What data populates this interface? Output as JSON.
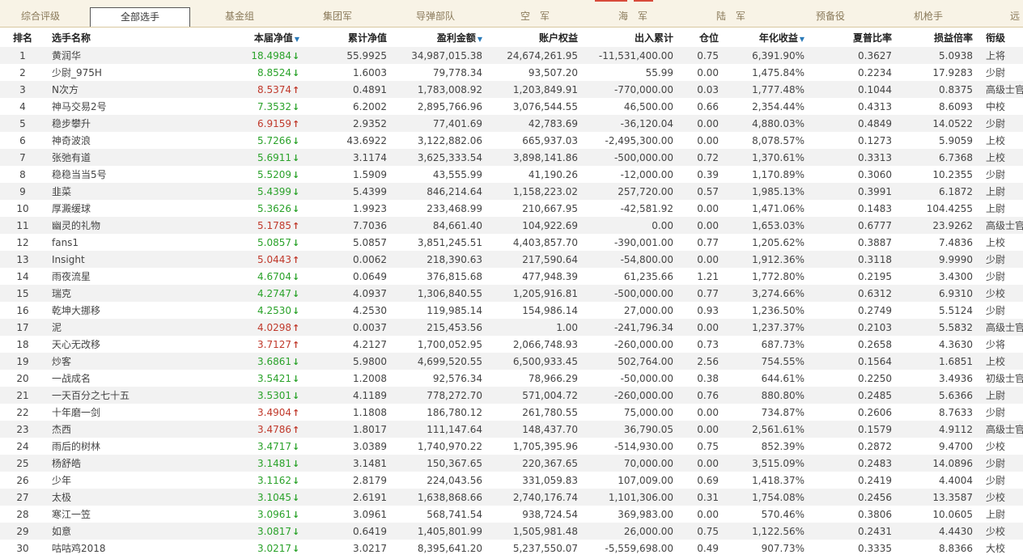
{
  "tabs": [
    {
      "label": "综合评级",
      "active": false
    },
    {
      "label": "全部选手",
      "active": true
    },
    {
      "label": "基金组",
      "active": false
    },
    {
      "label": "集团军",
      "active": false
    },
    {
      "label": "导弹部队",
      "active": false
    },
    {
      "label": "空　军",
      "active": false
    },
    {
      "label": "海　军",
      "active": false
    },
    {
      "label": "陆　军",
      "active": false
    },
    {
      "label": "预备役",
      "active": false
    },
    {
      "label": "机枪手",
      "active": false
    },
    {
      "label": "远",
      "active": false
    }
  ],
  "sort_indicator": "▼",
  "columns": [
    "排名",
    "选手名称",
    "本届净值",
    "累计净值",
    "盈利金额",
    "账户权益",
    "出入累计",
    "仓位",
    "年化收益",
    "夏普比率",
    "损益倍率",
    "衔级"
  ],
  "colors": {
    "up": "#c0392b",
    "down": "#2aa22a",
    "tab_bg": "#f8f3e6"
  },
  "rows": [
    {
      "rank": "1",
      "name": "黄润华",
      "nav": "18.4984",
      "dir": "down",
      "cum": "55.9925",
      "profit": "34,987,015.38",
      "equity": "24,674,261.95",
      "flow": "-11,531,400.00",
      "pos": "0.75",
      "annual": "6,391.90%",
      "sharpe": "0.3627",
      "ratio": "5.0938",
      "title": "上将"
    },
    {
      "rank": "2",
      "name": "少尉_975H",
      "nav": "8.8524",
      "dir": "down",
      "cum": "1.6003",
      "profit": "79,778.34",
      "equity": "93,507.20",
      "flow": "55.99",
      "pos": "0.00",
      "annual": "1,475.84%",
      "sharpe": "0.2234",
      "ratio": "17.9283",
      "title": "少尉"
    },
    {
      "rank": "3",
      "name": "N次方",
      "nav": "8.5374",
      "dir": "up",
      "cum": "0.4891",
      "profit": "1,783,008.92",
      "equity": "1,203,849.91",
      "flow": "-770,000.00",
      "pos": "0.03",
      "annual": "1,777.48%",
      "sharpe": "0.1044",
      "ratio": "0.8375",
      "title": "高级士官"
    },
    {
      "rank": "4",
      "name": "神马交易2号",
      "nav": "7.3532",
      "dir": "down",
      "cum": "6.2002",
      "profit": "2,895,766.96",
      "equity": "3,076,544.55",
      "flow": "46,500.00",
      "pos": "0.66",
      "annual": "2,354.44%",
      "sharpe": "0.4313",
      "ratio": "8.6093",
      "title": "中校"
    },
    {
      "rank": "5",
      "name": "稳步攀升",
      "nav": "6.9159",
      "dir": "up",
      "cum": "2.9352",
      "profit": "77,401.69",
      "equity": "42,783.69",
      "flow": "-36,120.04",
      "pos": "0.00",
      "annual": "4,880.03%",
      "sharpe": "0.4849",
      "ratio": "14.0522",
      "title": "少尉"
    },
    {
      "rank": "6",
      "name": "神奇波浪",
      "nav": "5.7266",
      "dir": "down",
      "cum": "43.6922",
      "profit": "3,122,882.06",
      "equity": "665,937.03",
      "flow": "-2,495,300.00",
      "pos": "0.00",
      "annual": "8,078.57%",
      "sharpe": "0.1273",
      "ratio": "5.9059",
      "title": "上校"
    },
    {
      "rank": "7",
      "name": "张弛有道",
      "nav": "5.6911",
      "dir": "down",
      "cum": "3.1174",
      "profit": "3,625,333.54",
      "equity": "3,898,141.86",
      "flow": "-500,000.00",
      "pos": "0.72",
      "annual": "1,370.61%",
      "sharpe": "0.3313",
      "ratio": "6.7368",
      "title": "上校"
    },
    {
      "rank": "8",
      "name": "稳稳当当5号",
      "nav": "5.5209",
      "dir": "down",
      "cum": "1.5909",
      "profit": "43,555.99",
      "equity": "41,190.26",
      "flow": "-12,000.00",
      "pos": "0.39",
      "annual": "1,170.89%",
      "sharpe": "0.3060",
      "ratio": "10.2355",
      "title": "少尉"
    },
    {
      "rank": "9",
      "name": "韭菜",
      "nav": "5.4399",
      "dir": "down",
      "cum": "5.4399",
      "profit": "846,214.64",
      "equity": "1,158,223.02",
      "flow": "257,720.00",
      "pos": "0.57",
      "annual": "1,985.13%",
      "sharpe": "0.3991",
      "ratio": "6.1872",
      "title": "上尉"
    },
    {
      "rank": "10",
      "name": "厚澱缓球",
      "nav": "5.3626",
      "dir": "down",
      "cum": "1.9923",
      "profit": "233,468.99",
      "equity": "210,667.95",
      "flow": "-42,581.92",
      "pos": "0.00",
      "annual": "1,471.06%",
      "sharpe": "0.1483",
      "ratio": "104.4255",
      "title": "上尉"
    },
    {
      "rank": "11",
      "name": "幽灵的礼物",
      "nav": "5.1785",
      "dir": "up",
      "cum": "7.7036",
      "profit": "84,661.40",
      "equity": "104,922.69",
      "flow": "0.00",
      "pos": "0.00",
      "annual": "1,653.03%",
      "sharpe": "0.6777",
      "ratio": "23.9262",
      "title": "高级士官"
    },
    {
      "rank": "12",
      "name": "fans1",
      "nav": "5.0857",
      "dir": "down",
      "cum": "5.0857",
      "profit": "3,851,245.51",
      "equity": "4,403,857.70",
      "flow": "-390,001.00",
      "pos": "0.77",
      "annual": "1,205.62%",
      "sharpe": "0.3887",
      "ratio": "7.4836",
      "title": "上校"
    },
    {
      "rank": "13",
      "name": "Insight",
      "nav": "5.0443",
      "dir": "up",
      "cum": "0.0062",
      "profit": "218,390.63",
      "equity": "217,590.64",
      "flow": "-54,800.00",
      "pos": "0.00",
      "annual": "1,912.36%",
      "sharpe": "0.3118",
      "ratio": "9.9990",
      "title": "少尉"
    },
    {
      "rank": "14",
      "name": "雨夜流星",
      "nav": "4.6704",
      "dir": "down",
      "cum": "0.0649",
      "profit": "376,815.68",
      "equity": "477,948.39",
      "flow": "61,235.66",
      "pos": "1.21",
      "annual": "1,772.80%",
      "sharpe": "0.2195",
      "ratio": "3.4300",
      "title": "少尉"
    },
    {
      "rank": "15",
      "name": "瑞克",
      "nav": "4.2747",
      "dir": "down",
      "cum": "4.0937",
      "profit": "1,306,840.55",
      "equity": "1,205,916.81",
      "flow": "-500,000.00",
      "pos": "0.77",
      "annual": "3,274.66%",
      "sharpe": "0.6312",
      "ratio": "6.9310",
      "title": "少校"
    },
    {
      "rank": "16",
      "name": "乾坤大挪移",
      "nav": "4.2530",
      "dir": "down",
      "cum": "4.2530",
      "profit": "119,985.14",
      "equity": "154,986.14",
      "flow": "27,000.00",
      "pos": "0.93",
      "annual": "1,236.50%",
      "sharpe": "0.2749",
      "ratio": "5.5124",
      "title": "少尉"
    },
    {
      "rank": "17",
      "name": "泥",
      "nav": "4.0298",
      "dir": "up",
      "cum": "0.0037",
      "profit": "215,453.56",
      "equity": "1.00",
      "flow": "-241,796.34",
      "pos": "0.00",
      "annual": "1,237.37%",
      "sharpe": "0.2103",
      "ratio": "5.5832",
      "title": "高级士官"
    },
    {
      "rank": "18",
      "name": "天心无改移",
      "nav": "3.7127",
      "dir": "up",
      "cum": "4.2127",
      "profit": "1,700,052.95",
      "equity": "2,066,748.93",
      "flow": "-260,000.00",
      "pos": "0.73",
      "annual": "687.73%",
      "sharpe": "0.2658",
      "ratio": "4.3630",
      "title": "少将"
    },
    {
      "rank": "19",
      "name": "炒客",
      "nav": "3.6861",
      "dir": "down",
      "cum": "5.9800",
      "profit": "4,699,520.55",
      "equity": "6,500,933.45",
      "flow": "502,764.00",
      "pos": "2.56",
      "annual": "754.55%",
      "sharpe": "0.1564",
      "ratio": "1.6851",
      "title": "上校"
    },
    {
      "rank": "20",
      "name": "一战成名",
      "nav": "3.5421",
      "dir": "down",
      "cum": "1.2008",
      "profit": "92,576.34",
      "equity": "78,966.29",
      "flow": "-50,000.00",
      "pos": "0.38",
      "annual": "644.61%",
      "sharpe": "0.2250",
      "ratio": "3.4936",
      "title": "初级士官"
    },
    {
      "rank": "21",
      "name": "一天百分之七十五",
      "nav": "3.5301",
      "dir": "down",
      "cum": "4.1189",
      "profit": "778,272.70",
      "equity": "571,004.72",
      "flow": "-260,000.00",
      "pos": "0.76",
      "annual": "880.80%",
      "sharpe": "0.2485",
      "ratio": "5.6366",
      "title": "上尉"
    },
    {
      "rank": "22",
      "name": "十年磨一剑",
      "nav": "3.4904",
      "dir": "up",
      "cum": "1.1808",
      "profit": "186,780.12",
      "equity": "261,780.55",
      "flow": "75,000.00",
      "pos": "0.00",
      "annual": "734.87%",
      "sharpe": "0.2606",
      "ratio": "8.7633",
      "title": "少尉"
    },
    {
      "rank": "23",
      "name": "杰西",
      "nav": "3.4786",
      "dir": "up",
      "cum": "1.8017",
      "profit": "111,147.64",
      "equity": "148,437.70",
      "flow": "36,790.05",
      "pos": "0.00",
      "annual": "2,561.61%",
      "sharpe": "0.1579",
      "ratio": "4.9112",
      "title": "高级士官"
    },
    {
      "rank": "24",
      "name": "雨后的树林",
      "nav": "3.4717",
      "dir": "down",
      "cum": "3.0389",
      "profit": "1,740,970.22",
      "equity": "1,705,395.96",
      "flow": "-514,930.00",
      "pos": "0.75",
      "annual": "852.39%",
      "sharpe": "0.2872",
      "ratio": "9.4700",
      "title": "少校"
    },
    {
      "rank": "25",
      "name": "杨舒皓",
      "nav": "3.1481",
      "dir": "down",
      "cum": "3.1481",
      "profit": "150,367.65",
      "equity": "220,367.65",
      "flow": "70,000.00",
      "pos": "0.00",
      "annual": "3,515.09%",
      "sharpe": "0.2483",
      "ratio": "14.0896",
      "title": "少尉"
    },
    {
      "rank": "26",
      "name": "少年",
      "nav": "3.1162",
      "dir": "down",
      "cum": "2.8179",
      "profit": "224,043.56",
      "equity": "331,059.83",
      "flow": "107,009.00",
      "pos": "0.69",
      "annual": "1,418.37%",
      "sharpe": "0.2419",
      "ratio": "4.4004",
      "title": "少尉"
    },
    {
      "rank": "27",
      "name": "太极",
      "nav": "3.1045",
      "dir": "down",
      "cum": "2.6191",
      "profit": "1,638,868.66",
      "equity": "2,740,176.74",
      "flow": "1,101,306.00",
      "pos": "0.31",
      "annual": "1,754.08%",
      "sharpe": "0.2456",
      "ratio": "13.3587",
      "title": "少校"
    },
    {
      "rank": "28",
      "name": "寒江一笠",
      "nav": "3.0961",
      "dir": "down",
      "cum": "3.0961",
      "profit": "568,741.54",
      "equity": "938,724.54",
      "flow": "369,983.00",
      "pos": "0.00",
      "annual": "570.46%",
      "sharpe": "0.3806",
      "ratio": "10.0605",
      "title": "上尉"
    },
    {
      "rank": "29",
      "name": "如意",
      "nav": "3.0817",
      "dir": "down",
      "cum": "0.6419",
      "profit": "1,405,801.99",
      "equity": "1,505,981.48",
      "flow": "26,000.00",
      "pos": "0.75",
      "annual": "1,122.56%",
      "sharpe": "0.2431",
      "ratio": "4.4430",
      "title": "少校"
    },
    {
      "rank": "30",
      "name": "咕咕鸡2018",
      "nav": "3.0217",
      "dir": "down",
      "cum": "3.0217",
      "profit": "8,395,641.20",
      "equity": "5,237,550.07",
      "flow": "-5,559,698.00",
      "pos": "0.49",
      "annual": "907.73%",
      "sharpe": "0.3335",
      "ratio": "8.8366",
      "title": "大校"
    }
  ]
}
